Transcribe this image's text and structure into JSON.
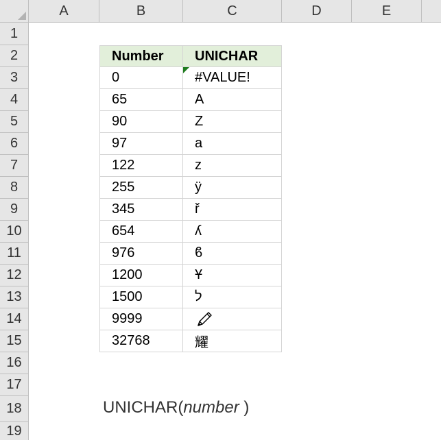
{
  "columns": [
    "A",
    "B",
    "C",
    "D",
    "E"
  ],
  "rows": [
    "1",
    "2",
    "3",
    "4",
    "5",
    "6",
    "7",
    "8",
    "9",
    "10",
    "11",
    "12",
    "13",
    "14",
    "15",
    "16",
    "17",
    "18",
    "19"
  ],
  "table": {
    "header_number": "Number",
    "header_unichar": "UNICHAR",
    "entries": [
      {
        "number": "0",
        "char": "#VALUE!"
      },
      {
        "number": "65",
        "char": "A"
      },
      {
        "number": "90",
        "char": "Z"
      },
      {
        "number": "97",
        "char": "a"
      },
      {
        "number": "122",
        "char": "z"
      },
      {
        "number": "255",
        "char": "ÿ"
      },
      {
        "number": "345",
        "char": "ř"
      },
      {
        "number": "654",
        "char": "ʎ"
      },
      {
        "number": "976",
        "char": "ϐ"
      },
      {
        "number": "1200",
        "char": "Ұ"
      },
      {
        "number": "1500",
        "char": "ל"
      },
      {
        "number": "9999",
        "char": "pencil-icon"
      },
      {
        "number": "32768",
        "char": "耀"
      }
    ]
  },
  "formula": {
    "fn": "UNICHAR(",
    "arg": "number",
    "close": " )"
  },
  "colors": {
    "header_fill": "#e2efda",
    "error_indicator": "#1e7b1e"
  }
}
